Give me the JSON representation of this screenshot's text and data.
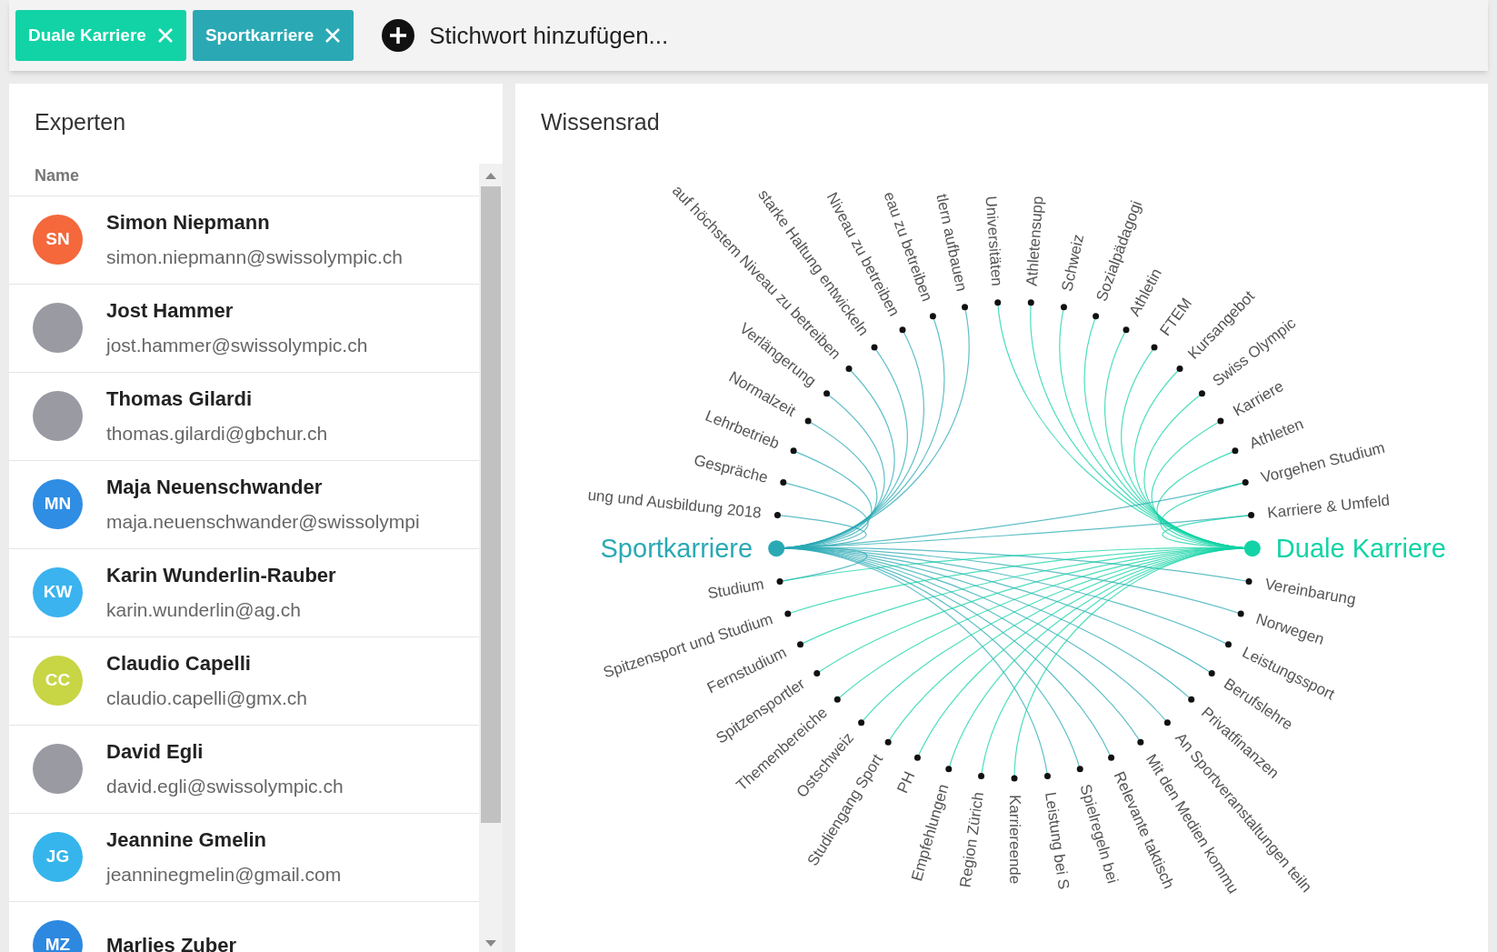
{
  "tag_bar": {
    "tags": [
      {
        "label": "Duale Karriere",
        "color": "#12d3a6"
      },
      {
        "label": "Sportkarriere",
        "color": "#2aa9b4"
      }
    ],
    "placeholder": "Stichwort hinzufügen..."
  },
  "experts": {
    "title": "Experten",
    "column": "Name",
    "rows": [
      {
        "name": "Simon Niepmann",
        "email": "simon.niepmann@swissolympic.ch",
        "avatar": {
          "kind": "initials",
          "initials": "SN",
          "color": "#f4683b"
        }
      },
      {
        "name": "Jost Hammer",
        "email": "jost.hammer@swissolympic.ch",
        "avatar": {
          "kind": "photo"
        }
      },
      {
        "name": "Thomas Gilardi",
        "email": "thomas.gilardi@gbchur.ch",
        "avatar": {
          "kind": "photo"
        }
      },
      {
        "name": "Maja Neuenschwander",
        "email": "maja.neuenschwander@swissolympi",
        "avatar": {
          "kind": "initials",
          "initials": "MN",
          "color": "#2f8de4"
        }
      },
      {
        "name": "Karin Wunderlin-Rauber",
        "email": "karin.wunderlin@ag.ch",
        "avatar": {
          "kind": "initials",
          "initials": "KW",
          "color": "#3bb3ef"
        }
      },
      {
        "name": "Claudio Capelli",
        "email": "claudio.capelli@gmx.ch",
        "avatar": {
          "kind": "initials",
          "initials": "CC",
          "color": "#c8d545"
        }
      },
      {
        "name": "David Egli",
        "email": "david.egli@swissolympic.ch",
        "avatar": {
          "kind": "photo"
        }
      },
      {
        "name": "Jeannine Gmelin",
        "email": "jeanninegmelin@gmail.com",
        "avatar": {
          "kind": "initials",
          "initials": "JG",
          "color": "#36b5ec"
        }
      },
      {
        "name": "Marlies Zuber",
        "avatar": {
          "kind": "initials",
          "initials": "MZ",
          "color": "#2d88e0"
        }
      }
    ]
  },
  "wheel": {
    "title": "Wissensrad",
    "nodes": [
      {
        "kind": "hub",
        "label": "Sportkarriere",
        "color": "#2aa9b4"
      },
      {
        "kind": "first_hub_leaf",
        "label": "ung und Ausbildung 2018"
      },
      {
        "kind": "first_hub_leaf",
        "label": "Gespräche"
      },
      {
        "kind": "first_hub_leaf",
        "label": "Lehrbetrieb"
      },
      {
        "kind": "first_hub_leaf",
        "label": "Normalzeit"
      },
      {
        "kind": "first_hub_leaf",
        "label": "Verlängerung"
      },
      {
        "kind": "first_hub_leaf",
        "label": "auf höchstem Niveau zu betreiben"
      },
      {
        "kind": "first_hub_leaf",
        "label": "starke Haltung entwickeln"
      },
      {
        "kind": "first_hub_leaf",
        "label": "Niveau zu betreiben"
      },
      {
        "kind": "first_hub_leaf",
        "label": "eau zu betreiben"
      },
      {
        "kind": "first_hub_leaf",
        "label": "tlern aufbauen"
      },
      {
        "kind": "second_hub_leaf",
        "label": "Universitäten"
      },
      {
        "kind": "second_hub_leaf",
        "label": "Athletensupp"
      },
      {
        "kind": "second_hub_leaf",
        "label": "Schweiz"
      },
      {
        "kind": "second_hub_leaf",
        "label": "Sozialpädagogi"
      },
      {
        "kind": "second_hub_leaf",
        "label": "Athletin"
      },
      {
        "kind": "second_hub_leaf",
        "label": "FTEM"
      },
      {
        "kind": "second_hub_leaf",
        "label": "Kursangebot"
      },
      {
        "kind": "second_hub_leaf",
        "label": "Swiss Olympic"
      },
      {
        "kind": "second_hub_leaf",
        "label": "Karriere"
      },
      {
        "kind": "second_hub_leaf",
        "label": "Athleten"
      },
      {
        "kind": "shared_leaf",
        "label": "Vorgehen Studium"
      },
      {
        "kind": "shared_leaf",
        "label": "Karriere & Umfeld"
      },
      {
        "kind": "hub",
        "label": "Duale Karriere",
        "color": "#12d3a6"
      },
      {
        "kind": "first_hub_leaf",
        "label": "Vereinbarung"
      },
      {
        "kind": "first_hub_leaf",
        "label": "Norwegen"
      },
      {
        "kind": "first_hub_leaf",
        "label": "Leistungssport"
      },
      {
        "kind": "first_hub_leaf",
        "label": "Berufslehre"
      },
      {
        "kind": "first_hub_leaf",
        "label": "Privatfinanzen"
      },
      {
        "kind": "first_hub_leaf",
        "label": "An Sportveranstaltungen teiln"
      },
      {
        "kind": "first_hub_leaf",
        "label": "Mit den Medien kommu"
      },
      {
        "kind": "first_hub_leaf",
        "label": "Relevante taktisch"
      },
      {
        "kind": "first_hub_leaf",
        "label": "Spielregeln bei"
      },
      {
        "kind": "first_hub_leaf",
        "label": "Leistung bei S"
      },
      {
        "kind": "second_hub_leaf",
        "label": "Karriereende"
      },
      {
        "kind": "second_hub_leaf",
        "label": "Region Zürich"
      },
      {
        "kind": "second_hub_leaf",
        "label": "Empfehlungen"
      },
      {
        "kind": "second_hub_leaf",
        "label": "PH"
      },
      {
        "kind": "second_hub_leaf",
        "label": "Studiengang Sport"
      },
      {
        "kind": "second_hub_leaf",
        "label": "Ostschweiz"
      },
      {
        "kind": "second_hub_leaf",
        "label": "Themenbereiche"
      },
      {
        "kind": "second_hub_leaf",
        "label": "Spitzensportler"
      },
      {
        "kind": "second_hub_leaf",
        "label": "Fernstudium"
      },
      {
        "kind": "second_hub_leaf",
        "label": "Spitzensport und Studium"
      },
      {
        "kind": "shared_leaf",
        "label": "Studium"
      }
    ]
  }
}
